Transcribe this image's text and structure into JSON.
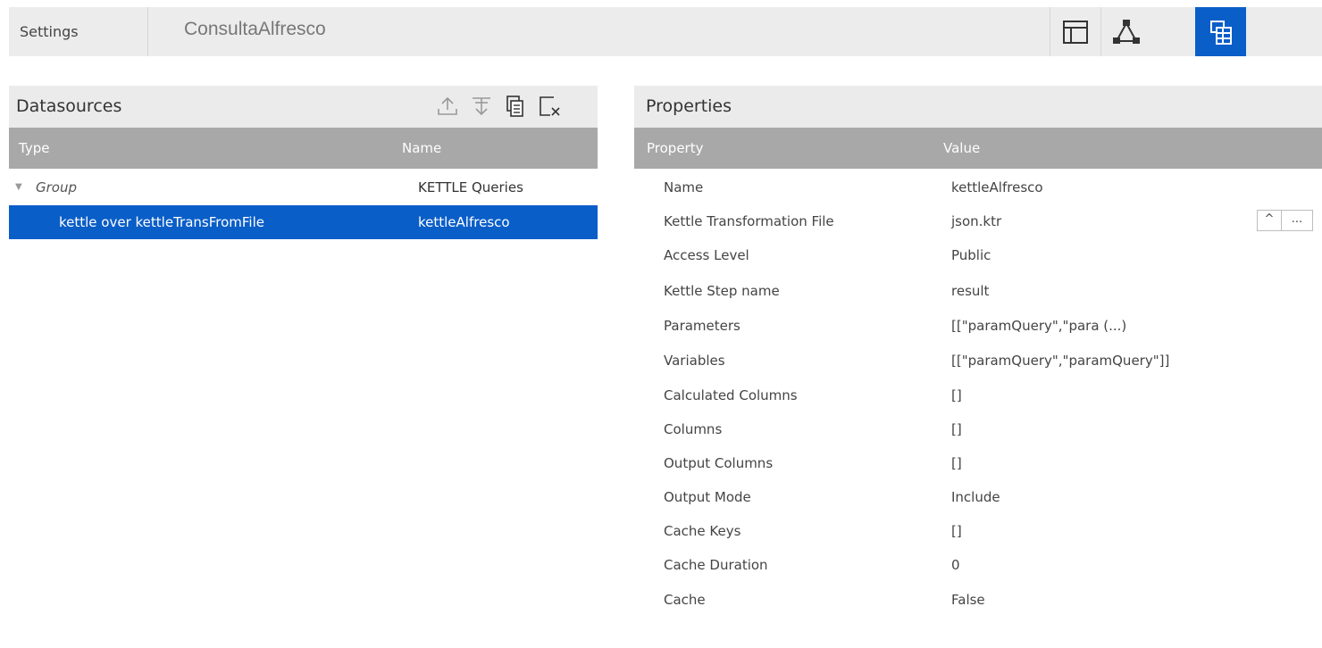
{
  "header": {
    "settings_label": "Settings",
    "dashboard_title": "ConsultaAlfresco",
    "views": [
      {
        "icon": "layout-panels-icon"
      },
      {
        "icon": "components-tree-icon"
      },
      {
        "icon": "datasources-icon",
        "active": true
      }
    ],
    "accent_color": "#0a5ec8"
  },
  "datasources": {
    "title": "Datasources",
    "tools": [
      "move-up-icon",
      "move-down-icon",
      "duplicate-icon",
      "delete-icon"
    ],
    "columns": [
      "Type",
      "Name"
    ],
    "rows": [
      {
        "type": "Group",
        "name": "KETTLE Queries",
        "expanded": true
      },
      {
        "type": "kettle over kettleTransFromFile",
        "name": "kettleAlfresco",
        "selected": true
      }
    ]
  },
  "properties": {
    "title": "Properties",
    "columns": [
      "Property",
      "Value"
    ],
    "rows": [
      {
        "property": "Name",
        "value": "kettleAlfresco"
      },
      {
        "property": "Kettle Transformation File",
        "value": "json.ktr"
      },
      {
        "property": "Access Level",
        "value": "Public"
      },
      {
        "property": "Kettle Step name",
        "value": "result"
      },
      {
        "property": "Parameters",
        "value": "[[\"paramQuery\",\"para (...)"
      },
      {
        "property": "Variables",
        "value": "[[\"paramQuery\",\"paramQuery\"]]"
      },
      {
        "property": "Calculated Columns",
        "value": "[]"
      },
      {
        "property": "Columns",
        "value": "[]"
      },
      {
        "property": "Output Columns",
        "value": "[]"
      },
      {
        "property": "Output Mode",
        "value": "Include"
      },
      {
        "property": "Cache Keys",
        "value": "[]"
      },
      {
        "property": "Cache Duration",
        "value": "0"
      },
      {
        "property": "Cache",
        "value": "False"
      }
    ],
    "file_buttons": {
      "up_label": "^",
      "browse_label": "..."
    }
  }
}
